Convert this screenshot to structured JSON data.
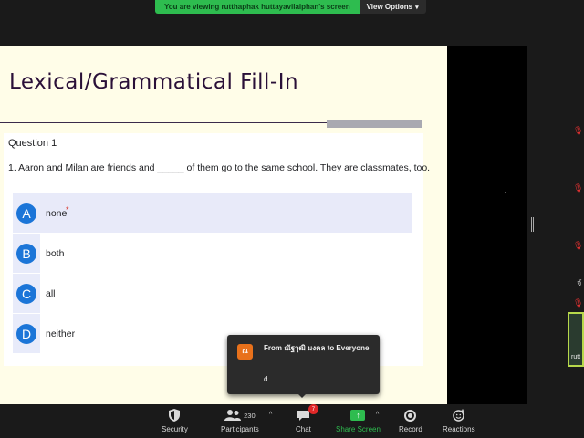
{
  "banner": {
    "viewing_text": "You are viewing rutthaphak huttayavilaiphan's screen",
    "view_options_label": "View Options",
    "chevron_icon": "chevron-down-icon"
  },
  "slide": {
    "title": "Lexical/Grammatical Fill-In",
    "question_heading": "Question 1",
    "question_text": "1. Aaron and Milan are friends and _____ of them go to the same school. They are classmates, too.",
    "required_marker": "*",
    "options": [
      {
        "letter": "A",
        "label": "none",
        "selected": true
      },
      {
        "letter": "B",
        "label": "both",
        "selected": false
      },
      {
        "letter": "C",
        "label": "all",
        "selected": false
      },
      {
        "letter": "D",
        "label": "neither",
        "selected": false
      }
    ]
  },
  "gallery": {
    "thai_char": "จั",
    "thumb_name": "rutt"
  },
  "chat_popup": {
    "avatar_initials": "ณ",
    "from_text": "From ณัฐวุฒิ มงคล to Everyone",
    "message": "d"
  },
  "toolbar": {
    "security": {
      "label": "Security",
      "icon": "shield-icon"
    },
    "participants": {
      "label": "Participants",
      "count": "230",
      "icon": "participants-icon"
    },
    "chat": {
      "label": "Chat",
      "badge": "7",
      "icon": "chat-icon"
    },
    "share_screen": {
      "label": "Share Screen",
      "icon": "share-screen-icon"
    },
    "record": {
      "label": "Record",
      "icon": "record-icon"
    },
    "reactions": {
      "label": "Reactions",
      "icon": "reactions-icon"
    },
    "caret": "^"
  },
  "colors": {
    "banner_green": "#2ebc4f",
    "option_blue": "#1b75d8",
    "chat_badge_red": "#e02828"
  }
}
